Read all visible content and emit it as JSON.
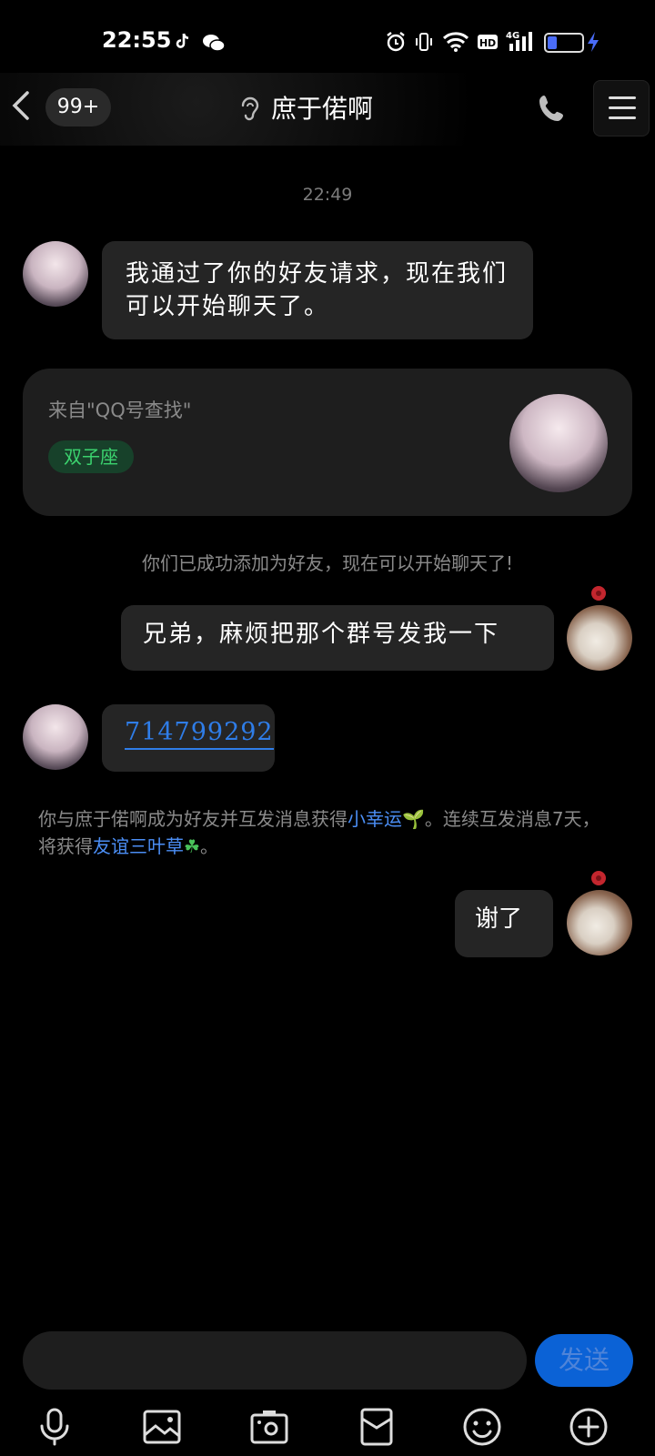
{
  "status_bar": {
    "time": "22:55",
    "icons": [
      "tiktok-icon",
      "wechat-icon",
      "alarm-icon",
      "vibrate-icon",
      "wifi-icon",
      "hd-icon",
      "signal-4g-icon",
      "battery-icon",
      "charging-icon"
    ],
    "battery_level": 0.3
  },
  "header": {
    "unread_badge": "99+",
    "title": "庶于偌啊"
  },
  "chat": {
    "timestamp": "22:49",
    "messages": [
      {
        "from": "friend",
        "text": "我通过了你的好友请求，现在我们可以开始聊天了。"
      },
      {
        "from": "self",
        "text": "兄弟，麻烦把那个群号发我一下"
      },
      {
        "from": "friend",
        "text": "714799292"
      },
      {
        "from": "self",
        "text": "谢了"
      }
    ],
    "profile_card": {
      "source": "来自\"QQ号查找\"",
      "tag": "双子座"
    },
    "system_1": "你们已成功添加为好友，现在可以开始聊天了!",
    "system_2": {
      "part1": "你与庶于偌啊成为好友并互发消息获得",
      "link1": "小幸运",
      "part2": "。连续互发消息7天，将获得",
      "link2": "友谊三叶草",
      "part3": "。"
    }
  },
  "input": {
    "send_label": "发送"
  },
  "toolbar": [
    "microphone-icon",
    "image-icon",
    "camera-icon",
    "red-packet-icon",
    "emoji-icon",
    "plus-icon"
  ],
  "colors": {
    "background": "#000000",
    "bubble": "#252525",
    "link": "#2f7de8",
    "send_button": "#0b62d6",
    "tag_green": "#3bd26e"
  }
}
